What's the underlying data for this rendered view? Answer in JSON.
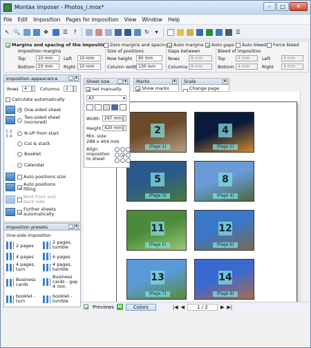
{
  "window": {
    "title": "Montax imposer - Photos_i.mox*"
  },
  "menu": [
    "File",
    "Edit",
    "Imposition",
    "Pages for imposition",
    "View",
    "Window",
    "Help"
  ],
  "margins_panel": {
    "title": "Margins and spacing of the imposition",
    "checks": [
      {
        "label": "Zero margins and spacing",
        "on": false
      },
      {
        "label": "Auto margins",
        "on": true
      },
      {
        "label": "Auto gaps",
        "on": true
      },
      {
        "label": "Auto bleed",
        "on": false
      },
      {
        "label": "Force bleed",
        "on": false
      }
    ],
    "imposition_margins": {
      "title": "Imposition margins",
      "top_label": "Top",
      "top": "10 mm",
      "left_label": "Left",
      "left": "10 mm",
      "bottom_label": "Bottom",
      "bottom": "10 mm",
      "right_label": "Right",
      "right": "10 mm"
    },
    "positions": {
      "title": "Size of positions",
      "row_label": "Row height",
      "row": "90 mm",
      "col_label": "Column width",
      "col": "130 mm"
    },
    "gaps": {
      "title": "Gaps between",
      "rows_label": "Rows",
      "rows": "8 mm",
      "cols_label": "Columns",
      "cols": "8 mm"
    },
    "bleed": {
      "title": "Bleed of imposition",
      "top_label": "Top",
      "top": "4 mm",
      "left_label": "Left",
      "left": "4 mm",
      "bottom_label": "Bottom",
      "bottom": "4 mm",
      "right_label": "Right",
      "right": "4 mm"
    }
  },
  "imposition_appearance": {
    "title": "Imposition appearance",
    "rows_label": "Rows",
    "rows": "4",
    "cols_label": "Columns",
    "cols": "2",
    "calc_auto": "Calculate automatically",
    "modes": [
      {
        "label": "One-sided sheet",
        "on": true
      },
      {
        "label": "Two-sided sheet (mirrored)",
        "on": false
      },
      {
        "label": "N-UP from start",
        "on": false
      },
      {
        "label": "Cut & stack",
        "on": false
      },
      {
        "label": "Booklet",
        "on": false
      },
      {
        "label": "Calendar",
        "on": false
      }
    ],
    "opts": [
      {
        "label": "Auto positions size",
        "on": false
      },
      {
        "label": "Auto positions filling",
        "on": true
      },
      {
        "label": "Bind front and back side",
        "on": false
      },
      {
        "label": "Further sheets automatically",
        "on": true
      }
    ]
  },
  "presets": {
    "title": "Imposition presets",
    "subtitle": "One-side imposition",
    "items": [
      "2 pages",
      "2 pages, tumble",
      "4 pages",
      "6 pages",
      "4 pages, turn",
      "4 pages, tumble",
      "Business cards",
      "Business cards - gap 4 mm",
      "booklet - turn",
      "booklet - tumble"
    ]
  },
  "sheet_size": {
    "title": "Sheet size",
    "set_manually": "Set manually",
    "preset": "A3",
    "width_label": "Width",
    "width": "297 mm",
    "height_label": "Height",
    "height": "420 mm",
    "min_label": "Min. size:",
    "min": "288 x 404 mm",
    "align_label": "Align imposition to sheet"
  },
  "marks": {
    "title": "Marks",
    "show": "Show marks"
  },
  "scale": {
    "title": "Scale",
    "change": "Change page size"
  },
  "pages": [
    {
      "num": "2",
      "label": "(Page 1)",
      "c1": "#6b4a2a",
      "c2": "#b8a080"
    },
    {
      "num": "4",
      "label": "(Page 2)",
      "c1": "#0a1a3a",
      "c2": "#d08a2a"
    },
    {
      "num": "5",
      "label": "(Page 3)",
      "c1": "#2a5a8a",
      "c2": "#4a7a3a"
    },
    {
      "num": "8",
      "label": "(Page 4)",
      "c1": "#6a9ad8",
      "c2": "#4a6a3a"
    },
    {
      "num": "11",
      "label": "(Page 5)",
      "c1": "#4a8a3a",
      "c2": "#9ac870"
    },
    {
      "num": "12",
      "label": "(Page 6)",
      "c1": "#3a78c8",
      "c2": "#7a6a50"
    },
    {
      "num": "13",
      "label": "(Page 7)",
      "c1": "#5a9ad8",
      "c2": "#5a8a3a"
    },
    {
      "num": "14",
      "label": "(Page 8)",
      "c1": "#3a6ad0",
      "c2": "#a86a50"
    }
  ],
  "status": {
    "previews": "Previews",
    "colors": "Colors",
    "page": "1 / 2"
  }
}
